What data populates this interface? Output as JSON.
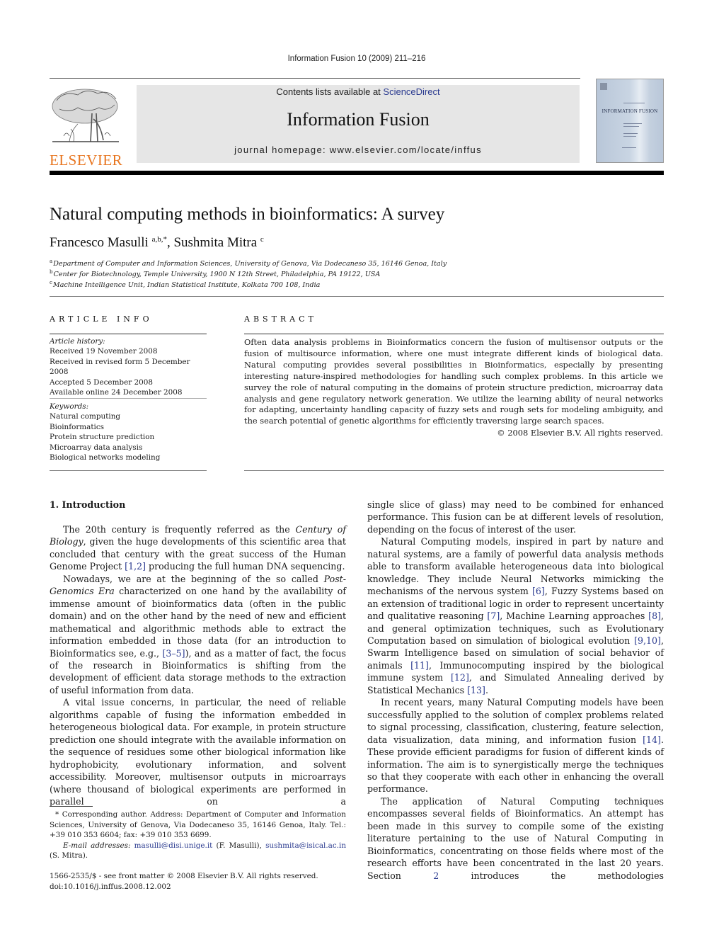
{
  "running_head": "Information Fusion 10 (2009) 211–216",
  "publisher": {
    "logo_icon": "elsevier-tree-logo",
    "name": "ELSEVIER",
    "brand_color": "#e87722"
  },
  "banner": {
    "contents_prefix": "Contents lists available at ",
    "contents_link": "ScienceDirect",
    "journal_title": "Information Fusion",
    "homepage": "journal homepage: www.elsevier.com/locate/inffus"
  },
  "cover": {
    "icon": "journal-cover-thumbnail",
    "title": "INFORMATION FUSION"
  },
  "article": {
    "title": "Natural computing methods in bioinformatics: A survey",
    "authors": [
      {
        "name": "Francesco Masulli",
        "sup": "a,b,*"
      },
      {
        "name": "Sushmita Mitra",
        "sup": "c"
      }
    ],
    "author_separator": ", ",
    "affiliations": [
      {
        "mark": "a",
        "text": "Department of Computer and Information Sciences, University of Genova, Via Dodecaneso 35, 16146 Genoa, Italy"
      },
      {
        "mark": "b",
        "text": "Center for Biotechnology, Temple University, 1900 N 12th Street, Philadelphia, PA 19122, USA"
      },
      {
        "mark": "c",
        "text": "Machine Intelligence Unit, Indian Statistical Institute, Kolkata 700 108, India"
      }
    ]
  },
  "article_info": {
    "heading": "ARTICLE INFO",
    "history_label": "Article history:",
    "history": [
      "Received 19 November 2008",
      "Received in revised form 5 December 2008",
      "Accepted 5 December 2008",
      "Available online 24 December 2008"
    ],
    "keywords_label": "Keywords:",
    "keywords": [
      "Natural computing",
      "Bioinformatics",
      "Protein structure prediction",
      "Microarray data analysis",
      "Biological networks modeling"
    ]
  },
  "abstract": {
    "heading": "ABSTRACT",
    "text": "Often data analysis problems in Bioinformatics concern the fusion of multisensor outputs or the fusion of multisource information, where one must integrate different kinds of biological data. Natural computing provides several possibilities in Bioinformatics, especially by presenting interesting nature-inspired methodologies for handling such complex problems. In this article we survey the role of natural computing in the domains of protein structure prediction, microarray data analysis and gene regulatory network generation. We utilize the learning ability of neural networks for adapting, uncertainty handling capacity of fuzzy sets and rough sets for modeling ambiguity, and the search potential of genetic algorithms for efficiently traversing large search spaces.",
    "copyright": "© 2008 Elsevier B.V. All rights reserved."
  },
  "intro": {
    "heading": "1. Introduction",
    "p1": {
      "a": "The 20th century is frequently referred as the ",
      "it": "Century of Biology",
      "b": ", given the huge developments of this scientific area that concluded that century with the great success of the Human Genome Project ",
      "ref": "[1,2]",
      "c": " producing the full human DNA sequencing."
    },
    "p2": {
      "a": "Nowadays, we are at the beginning of the so called ",
      "it": "Post-Genomics Era",
      "b": " characterized on one hand by the availability of immense amount of bioinformatics data (often in the public domain) and on the other hand by the need of new and efficient mathematical and algorithmic methods able to extract the information embedded in those data (for an introduction to Bioinformatics see, e.g., ",
      "ref": "[3–5]",
      "c": "), and as a matter of fact, the focus of the research in Bioinformatics is shifting from the development of efficient data storage methods to the extraction of useful information from data."
    },
    "p3": "A vital issue concerns, in particular, the need of reliable algorithms capable of fusing the information embedded in heterogeneous biological data. For example, in protein structure prediction one should integrate with the available information on the sequence of residues some other biological information like hydrophobicity, evolutionary information, and solvent accessibility. Moreover, multisensor outputs in microarrays (where thousand of biological experiments are performed in parallel on a",
    "p3_cont": "single slice of glass) may need to be combined for enhanced performance. This fusion can be at different levels of resolution, depending on the focus of interest of the user.",
    "p4": {
      "a": "Natural Computing models, inspired in part by nature and natural systems, are a family of powerful data analysis methods able to transform available heterogeneous data into biological knowledge. They include Neural Networks mimicking the mechanisms of the nervous system ",
      "r1": "[6]",
      "b": ", Fuzzy Systems based on an extension of traditional logic in order to represent uncertainty and qualitative reasoning ",
      "r2": "[7]",
      "c": ", Machine Learning approaches ",
      "r3": "[8]",
      "d": ", and general optimization techniques, such as Evolutionary Computation based on simulation of biological evolution ",
      "r4": "[9,10]",
      "e": ", Swarm Intelligence based on simulation of social behavior of animals ",
      "r5": "[11]",
      "f": ", Immunocomputing inspired by the biological immune system ",
      "r6": "[12]",
      "g": ", and Simulated Annealing derived by Statistical Mechanics ",
      "r7": "[13]",
      "h": "."
    },
    "p5": {
      "a": "In recent years, many Natural Computing models have been successfully applied to the solution of complex problems related to signal processing, classification, clustering, feature selection, data visualization, data mining, and information fusion ",
      "ref": "[14]",
      "b": ". These provide efficient paradigms for fusion of different kinds of information. The aim is to synergistically merge the techniques so that they cooperate with each other in enhancing the overall performance."
    },
    "p6": {
      "a": "The application of Natural Computing techniques encompasses several fields of Bioinformatics. An attempt has been made in this survey to compile some of the existing literature pertaining to the use of Natural Computing in Bioinformatics, concentrating on those fields where most of the research efforts have been concentrated in the last 20 years. Section ",
      "ref": "2",
      "b": " introduces the methodologies"
    }
  },
  "footnote": {
    "corresponding": "* Corresponding author. Address: Department of Computer and Information Sciences, University of Genova, Via Dodecaneso 35, 16146 Genoa, Italy. Tel.: +39 010 353 6604; fax: +39 010 353 6699.",
    "email_label": "E-mail addresses:",
    "email1": "masulli@disi.unige.it",
    "email1_owner": " (F. Masulli), ",
    "email2": "sushmita@isical.ac.in",
    "email2_owner": " (S. Mitra)."
  },
  "front_matter": {
    "issn": "1566-2535/$ - see front matter © 2008 Elsevier B.V. All rights reserved.",
    "doi": "doi:10.1016/j.inffus.2008.12.002"
  },
  "colors": {
    "link": "#2a3a8f",
    "banner_bg": "#e6e6e6"
  }
}
